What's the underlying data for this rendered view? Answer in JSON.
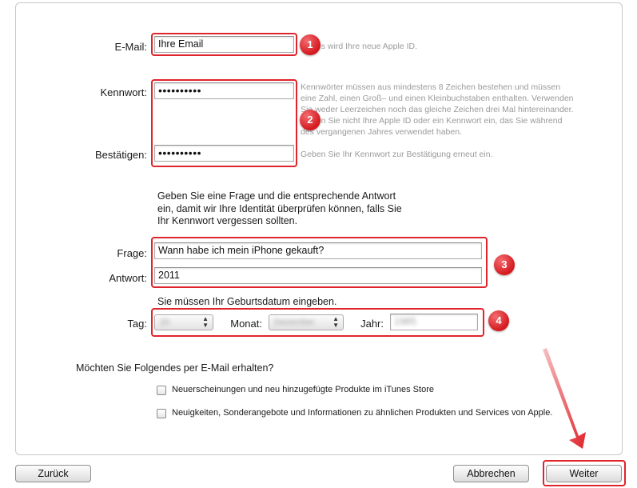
{
  "form": {
    "email_label": "E-Mail:",
    "email_value": "Ihre Email",
    "email_hint": "Dies wird Ihre neue Apple ID.",
    "password_label": "Kennwort:",
    "password_value": "••••••••••",
    "password_hint_lines": [
      "Kennwörter müssen aus mindestens 8 Zeichen bestehen und müssen",
      "eine Zahl, einen Groß– und einen Kleinbuchstaben enthalten. Verwenden",
      "Sie weder Leerzeichen noch das gleiche Zeichen drei Mal hintereinander.",
      "Geben Sie nicht Ihre Apple ID oder ein Kennwort ein, das Sie während",
      "des vergangenen Jahres verwendet haben."
    ],
    "confirm_label": "Bestätigen:",
    "confirm_value": "••••••••••",
    "confirm_hint": "Geben Sie Ihr Kennwort zur Bestätigung erneut ein.",
    "security_intro_lines": [
      "Geben Sie eine Frage und die entsprechende Antwort",
      "ein, damit wir Ihre Identität überprüfen können, falls Sie",
      "Ihr Kennwort vergessen sollten."
    ],
    "question_label": "Frage:",
    "question_value": "Wann habe ich mein iPhone gekauft?",
    "answer_label": "Antwort:",
    "answer_value": "2011",
    "birthdate_intro": "Sie müssen Ihr Geburtsdatum eingeben.",
    "day_label": "Tag:",
    "day_value": "20",
    "month_label": "Monat:",
    "month_value": "Dezember",
    "year_label": "Jahr:",
    "year_value": "1985",
    "newsletter_question": "Möchten Sie Folgendes per E-Mail erhalten?",
    "newsletter_option_1": "Neuerscheinungen und neu hinzugefügte Produkte im iTunes Store",
    "newsletter_option_2": "Neuigkeiten, Sonderangebote und Informationen zu ähnlichen Produkten und Services von Apple."
  },
  "badges": {
    "one": "1",
    "two": "2",
    "three": "3",
    "four": "4"
  },
  "buttons": {
    "back": "Zurück",
    "cancel": "Abbrechen",
    "next": "Weiter"
  },
  "colors": {
    "annotation": "#e0242b"
  }
}
